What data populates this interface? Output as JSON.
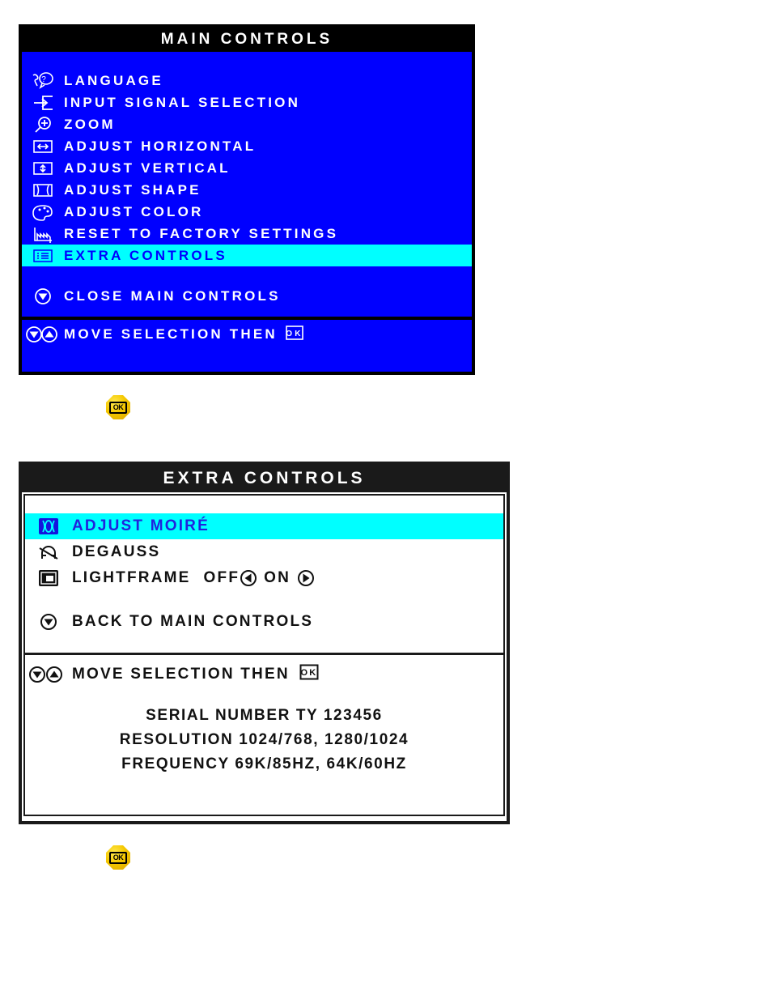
{
  "main_controls": {
    "title": "MAIN CONTROLS",
    "items": [
      {
        "icon": "language-icon",
        "label": "LANGUAGE",
        "selected": false
      },
      {
        "icon": "input-signal-icon",
        "label": "INPUT SIGNAL SELECTION",
        "selected": false
      },
      {
        "icon": "zoom-icon",
        "label": "ZOOM",
        "selected": false
      },
      {
        "icon": "adjust-horizontal-icon",
        "label": "ADJUST HORIZONTAL",
        "selected": false
      },
      {
        "icon": "adjust-vertical-icon",
        "label": "ADJUST VERTICAL",
        "selected": false
      },
      {
        "icon": "adjust-shape-icon",
        "label": "ADJUST SHAPE",
        "selected": false
      },
      {
        "icon": "adjust-color-icon",
        "label": "ADJUST COLOR",
        "selected": false
      },
      {
        "icon": "reset-factory-icon",
        "label": "RESET TO FACTORY SETTINGS",
        "selected": false
      },
      {
        "icon": "extra-controls-icon",
        "label": "EXTRA CONTROLS",
        "selected": true
      }
    ],
    "close_item": {
      "icon": "down-arrow-circle-icon",
      "label": "CLOSE MAIN CONTROLS"
    },
    "footer": {
      "icons": "down-up-arrow-circle-icons",
      "label": "MOVE SELECTION THEN",
      "ok_icon": "ok-key-icon"
    },
    "colors": {
      "background": "#0000FF",
      "highlight": "#00FFFF",
      "titlebar": "#000000",
      "text": "#FFFFFF",
      "highlight_text": "#0000FF"
    }
  },
  "extra_controls": {
    "title": "EXTRA CONTROLS",
    "items": [
      {
        "icon": "adjust-moire-icon",
        "label": "ADJUST MOIRÉ",
        "selected": true
      },
      {
        "icon": "degauss-icon",
        "label": "DEGAUSS",
        "selected": false
      }
    ],
    "lightframe": {
      "icon": "lightframe-icon",
      "label": "LIGHTFRAME",
      "off_label": "OFF",
      "left_arrow_icon": "left-arrow-circle-icon",
      "on_label": "ON",
      "right_arrow_icon": "right-arrow-circle-icon"
    },
    "back_item": {
      "icon": "down-arrow-circle-icon",
      "label": "BACK TO MAIN CONTROLS"
    },
    "footer": {
      "icons": "down-up-arrow-circle-icons",
      "label": "MOVE SELECTION THEN",
      "ok_icon": "ok-key-icon"
    },
    "info": {
      "serial": "SERIAL NUMBER TY 123456",
      "resolution": "RESOLUTION 1024/768, 1280/1024",
      "frequency": "FREQUENCY 69K/85HZ, 64K/60HZ"
    },
    "colors": {
      "background": "#FFFFFF",
      "highlight": "#00FFFF",
      "titlebar": "#1A1A1A",
      "text": "#111111",
      "highlight_text": "#2222DD"
    }
  },
  "ok_buttons": [
    {
      "name": "ok-button-main",
      "label": "OK"
    },
    {
      "name": "ok-button-extra",
      "label": "OK"
    }
  ]
}
